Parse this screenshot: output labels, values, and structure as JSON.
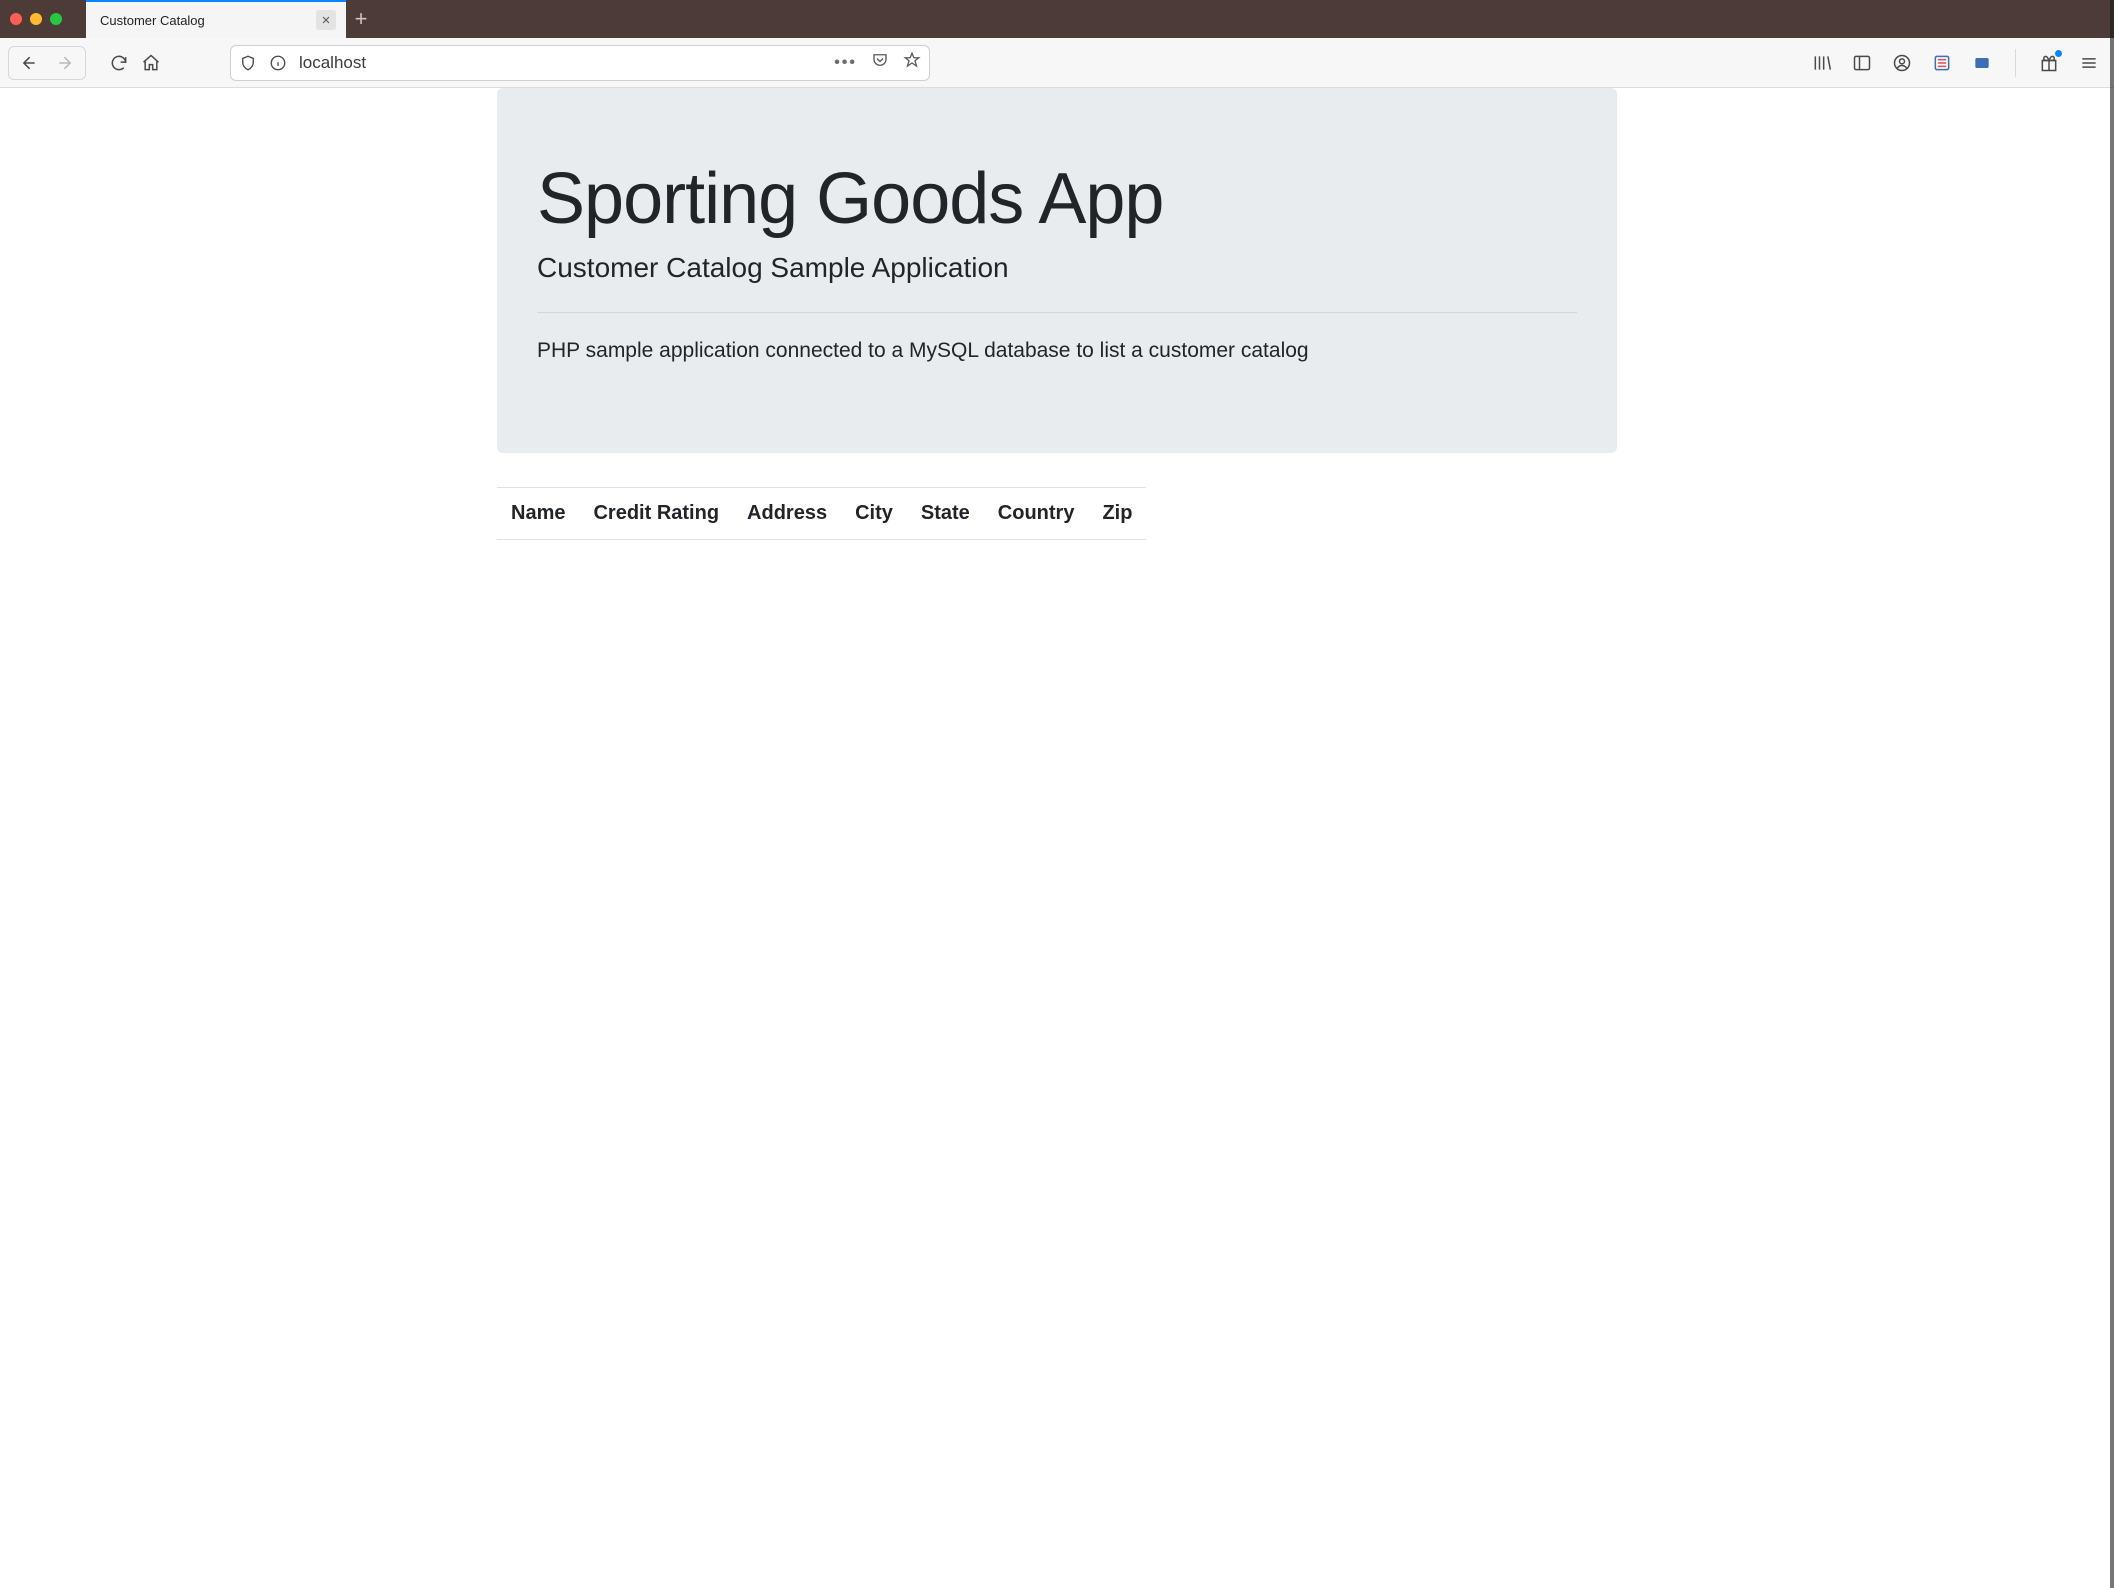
{
  "browser": {
    "tab_title": "Customer Catalog",
    "url": "localhost"
  },
  "jumbotron": {
    "title": "Sporting Goods App",
    "subtitle": "Customer Catalog Sample Application",
    "description": "PHP sample application connected to a MySQL database to list a customer catalog"
  },
  "table": {
    "columns": [
      "Name",
      "Credit Rating",
      "Address",
      "City",
      "State",
      "Country",
      "Zip"
    ],
    "rows": []
  }
}
